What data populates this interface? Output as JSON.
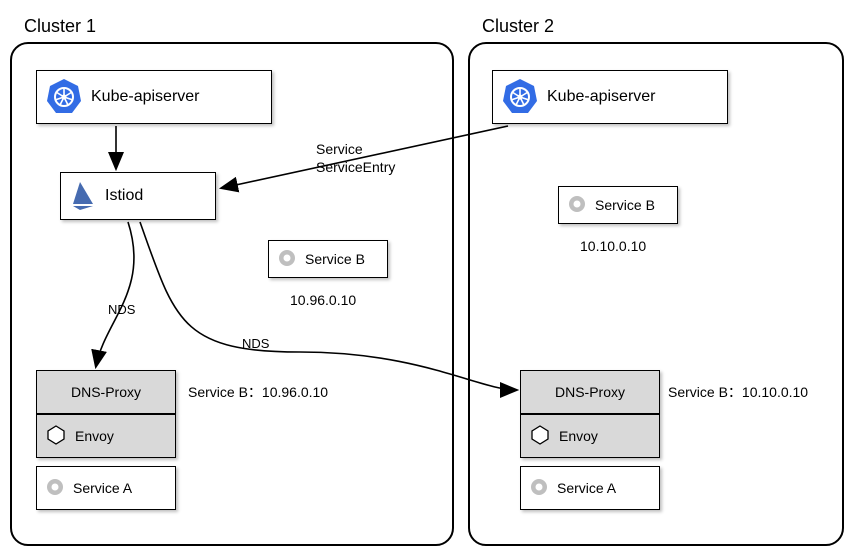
{
  "clusters": [
    {
      "title": "Cluster 1"
    },
    {
      "title": "Cluster 2"
    }
  ],
  "boxes": {
    "kubeapi1": "Kube-apiserver",
    "kubeapi2": "Kube-apiserver",
    "istiod": "Istiod",
    "serviceB1": "Service B",
    "serviceB1_ip": "10.96.0.10",
    "serviceB2": "Service B",
    "serviceB2_ip": "10.10.0.10",
    "dnsproxy1": "DNS-Proxy",
    "dnsproxy2": "DNS-Proxy",
    "envoy1": "Envoy",
    "envoy2": "Envoy",
    "serviceA1": "Service A",
    "serviceA2": "Service A"
  },
  "labels": {
    "service_entry_l1": "Service",
    "service_entry_l2": "ServiceEntry",
    "nds1": "NDS",
    "nds2": "NDS",
    "serviceB_map1": "Service B：10.96.0.10",
    "serviceB_map2": "Service B：10.10.0.10"
  }
}
